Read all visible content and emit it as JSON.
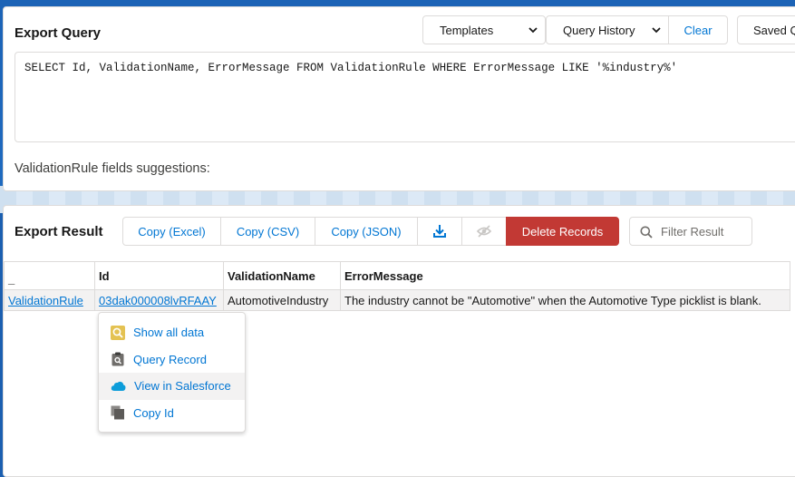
{
  "query_panel": {
    "title": "Export Query",
    "templates_label": "Templates",
    "history_label": "Query History",
    "clear_label": "Clear",
    "saved_label": "Saved Q",
    "query_text": "SELECT Id, ValidationName, ErrorMessage FROM ValidationRule WHERE ErrorMessage LIKE '%industry%'",
    "suggestions_label": "ValidationRule fields suggestions:"
  },
  "result_panel": {
    "title": "Export Result",
    "copy_excel": "Copy (Excel)",
    "copy_csv": "Copy (CSV)",
    "copy_json": "Copy (JSON)",
    "delete_label": "Delete Records",
    "filter_placeholder": "Filter Result"
  },
  "table": {
    "headers": [
      "_",
      "Id",
      "ValidationName",
      "ErrorMessage"
    ],
    "rows": [
      {
        "type": "ValidationRule",
        "id": "03dak000008lvRFAAY",
        "validation_name": "AutomotiveIndustry",
        "error_message": "The industry cannot be \"Automotive\" when the Automotive Type picklist is blank."
      }
    ]
  },
  "context_menu": {
    "items": [
      {
        "label": "Show all data",
        "icon": "zoom-icon"
      },
      {
        "label": "Query Record",
        "icon": "clipboard-icon"
      },
      {
        "label": "View in Salesforce",
        "icon": "cloud-icon"
      },
      {
        "label": "Copy Id",
        "icon": "copy-icon"
      }
    ]
  },
  "colors": {
    "accent": "#0176d3",
    "danger": "#c23934",
    "background": "#1b5fb0"
  }
}
